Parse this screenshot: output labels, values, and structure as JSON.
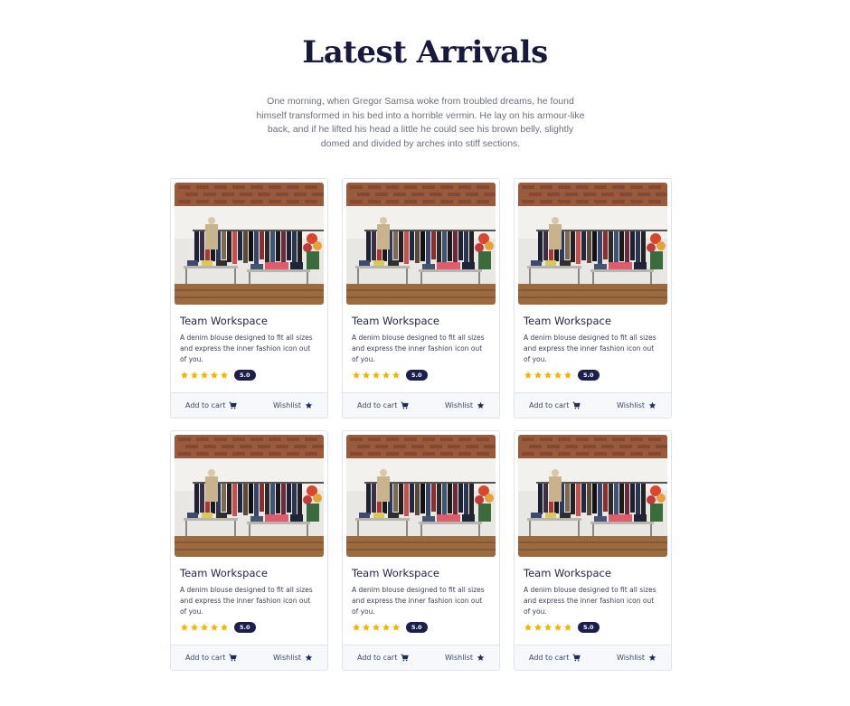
{
  "section": {
    "title": "Latest Arrivals",
    "description": "One morning, when Gregor Samsa woke from troubled dreams, he found himself transformed in his bed into a horrible vermin. He lay on his armour-like back, and if he lifted his head a little he could see his brown belly, slightly domed and divided by arches into stiff sections."
  },
  "colors": {
    "title": "#17193d",
    "star": "#f5b400",
    "badge": "#1c1f4d",
    "footer_bg": "#f6f8fb"
  },
  "products": [
    {
      "title": "Team Workspace",
      "description": "A denim blouse designed to fit all sizes and express the inner fashion icon out of you.",
      "rating": "5.0",
      "stars": 5,
      "add_to_cart_label": "Add to cart",
      "wishlist_label": "Wishlist",
      "image_alt": "clothing store interior"
    },
    {
      "title": "Team Workspace",
      "description": "A denim blouse designed to fit all sizes and express the inner fashion icon out of you.",
      "rating": "5.0",
      "stars": 5,
      "add_to_cart_label": "Add to cart",
      "wishlist_label": "Wishlist",
      "image_alt": "clothing store interior"
    },
    {
      "title": "Team Workspace",
      "description": "A denim blouse designed to fit all sizes and express the inner fashion icon out of you.",
      "rating": "5.0",
      "stars": 5,
      "add_to_cart_label": "Add to cart",
      "wishlist_label": "Wishlist",
      "image_alt": "clothing store interior"
    },
    {
      "title": "Team Workspace",
      "description": "A denim blouse designed to fit all sizes and express the inner fashion icon out of you.",
      "rating": "5.0",
      "stars": 5,
      "add_to_cart_label": "Add to cart",
      "wishlist_label": "Wishlist",
      "image_alt": "clothing store interior"
    },
    {
      "title": "Team Workspace",
      "description": "A denim blouse designed to fit all sizes and express the inner fashion icon out of you.",
      "rating": "5.0",
      "stars": 5,
      "add_to_cart_label": "Add to cart",
      "wishlist_label": "Wishlist",
      "image_alt": "clothing store interior"
    },
    {
      "title": "Team Workspace",
      "description": "A denim blouse designed to fit all sizes and express the inner fashion icon out of you.",
      "rating": "5.0",
      "stars": 5,
      "add_to_cart_label": "Add to cart",
      "wishlist_label": "Wishlist",
      "image_alt": "clothing store interior"
    }
  ],
  "icons": {
    "star": "star-icon",
    "cart": "cart-icon",
    "wishlist": "star-icon"
  }
}
